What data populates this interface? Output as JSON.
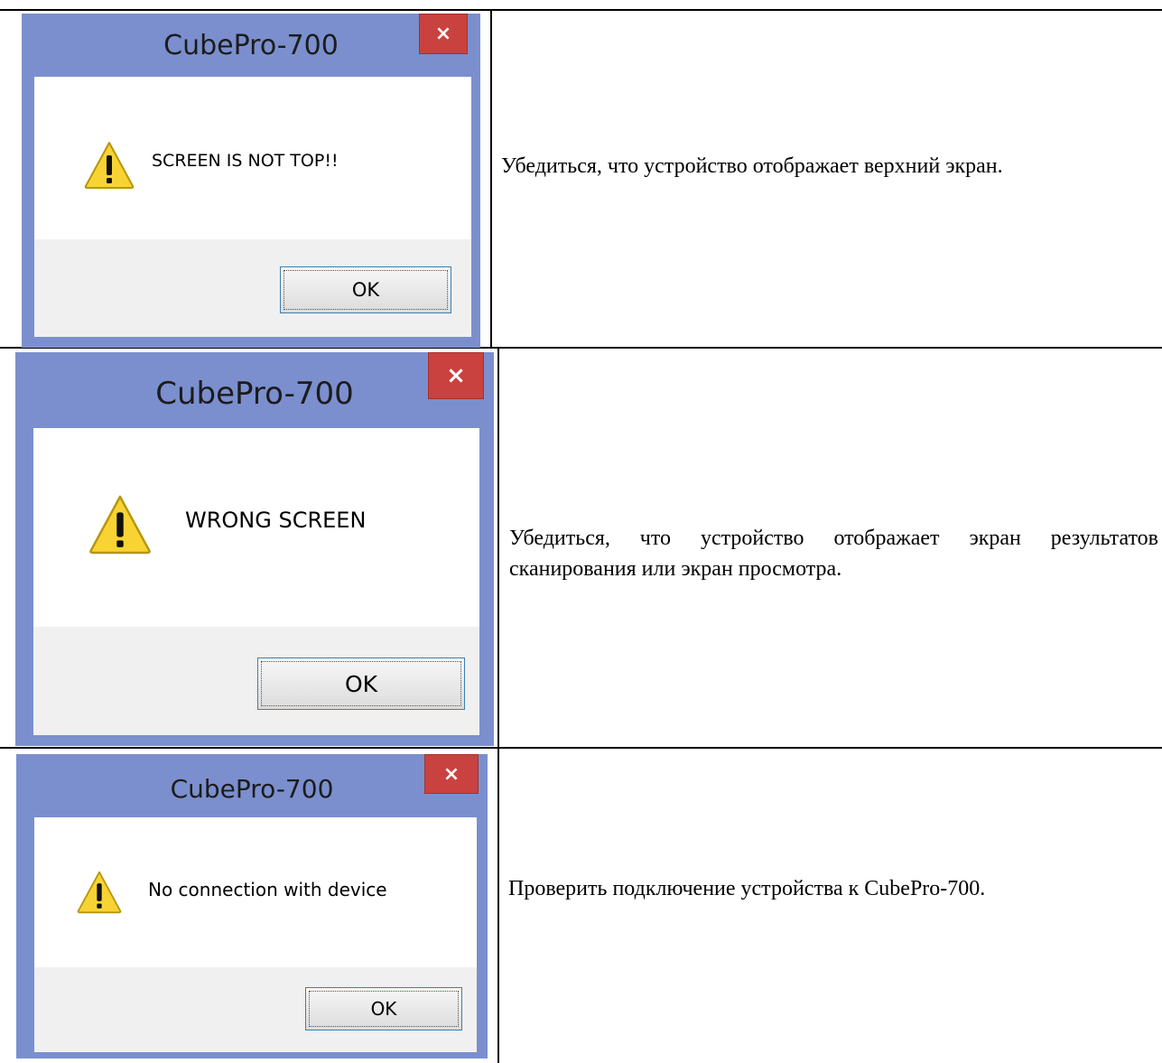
{
  "colors": {
    "window_frame": "#7b8fce",
    "close_button": "#c9423f",
    "client_area": "#ffffff",
    "button_area": "#f0f0f0",
    "ok_border": "#3c7fb1"
  },
  "rows": [
    {
      "dialog": {
        "title": "CubePro-700",
        "close_symbol": "×",
        "icon": "warning-icon",
        "message": "SCREEN IS NOT TOP!!",
        "ok_label": "OK"
      },
      "description": "Убедиться, что устройство отображает верхний экран."
    },
    {
      "dialog": {
        "title": "CubePro-700",
        "close_symbol": "×",
        "icon": "warning-icon",
        "message": "WRONG SCREEN",
        "ok_label": "OK"
      },
      "description": "Убедиться, что устройство отображает экран результатов сканирования или экран просмотра."
    },
    {
      "dialog": {
        "title": "CubePro-700",
        "close_symbol": "×",
        "icon": "warning-icon",
        "message": "No connection with device",
        "ok_label": "OK"
      },
      "description": "Проверить подключение устройства к CubePro-700."
    }
  ]
}
